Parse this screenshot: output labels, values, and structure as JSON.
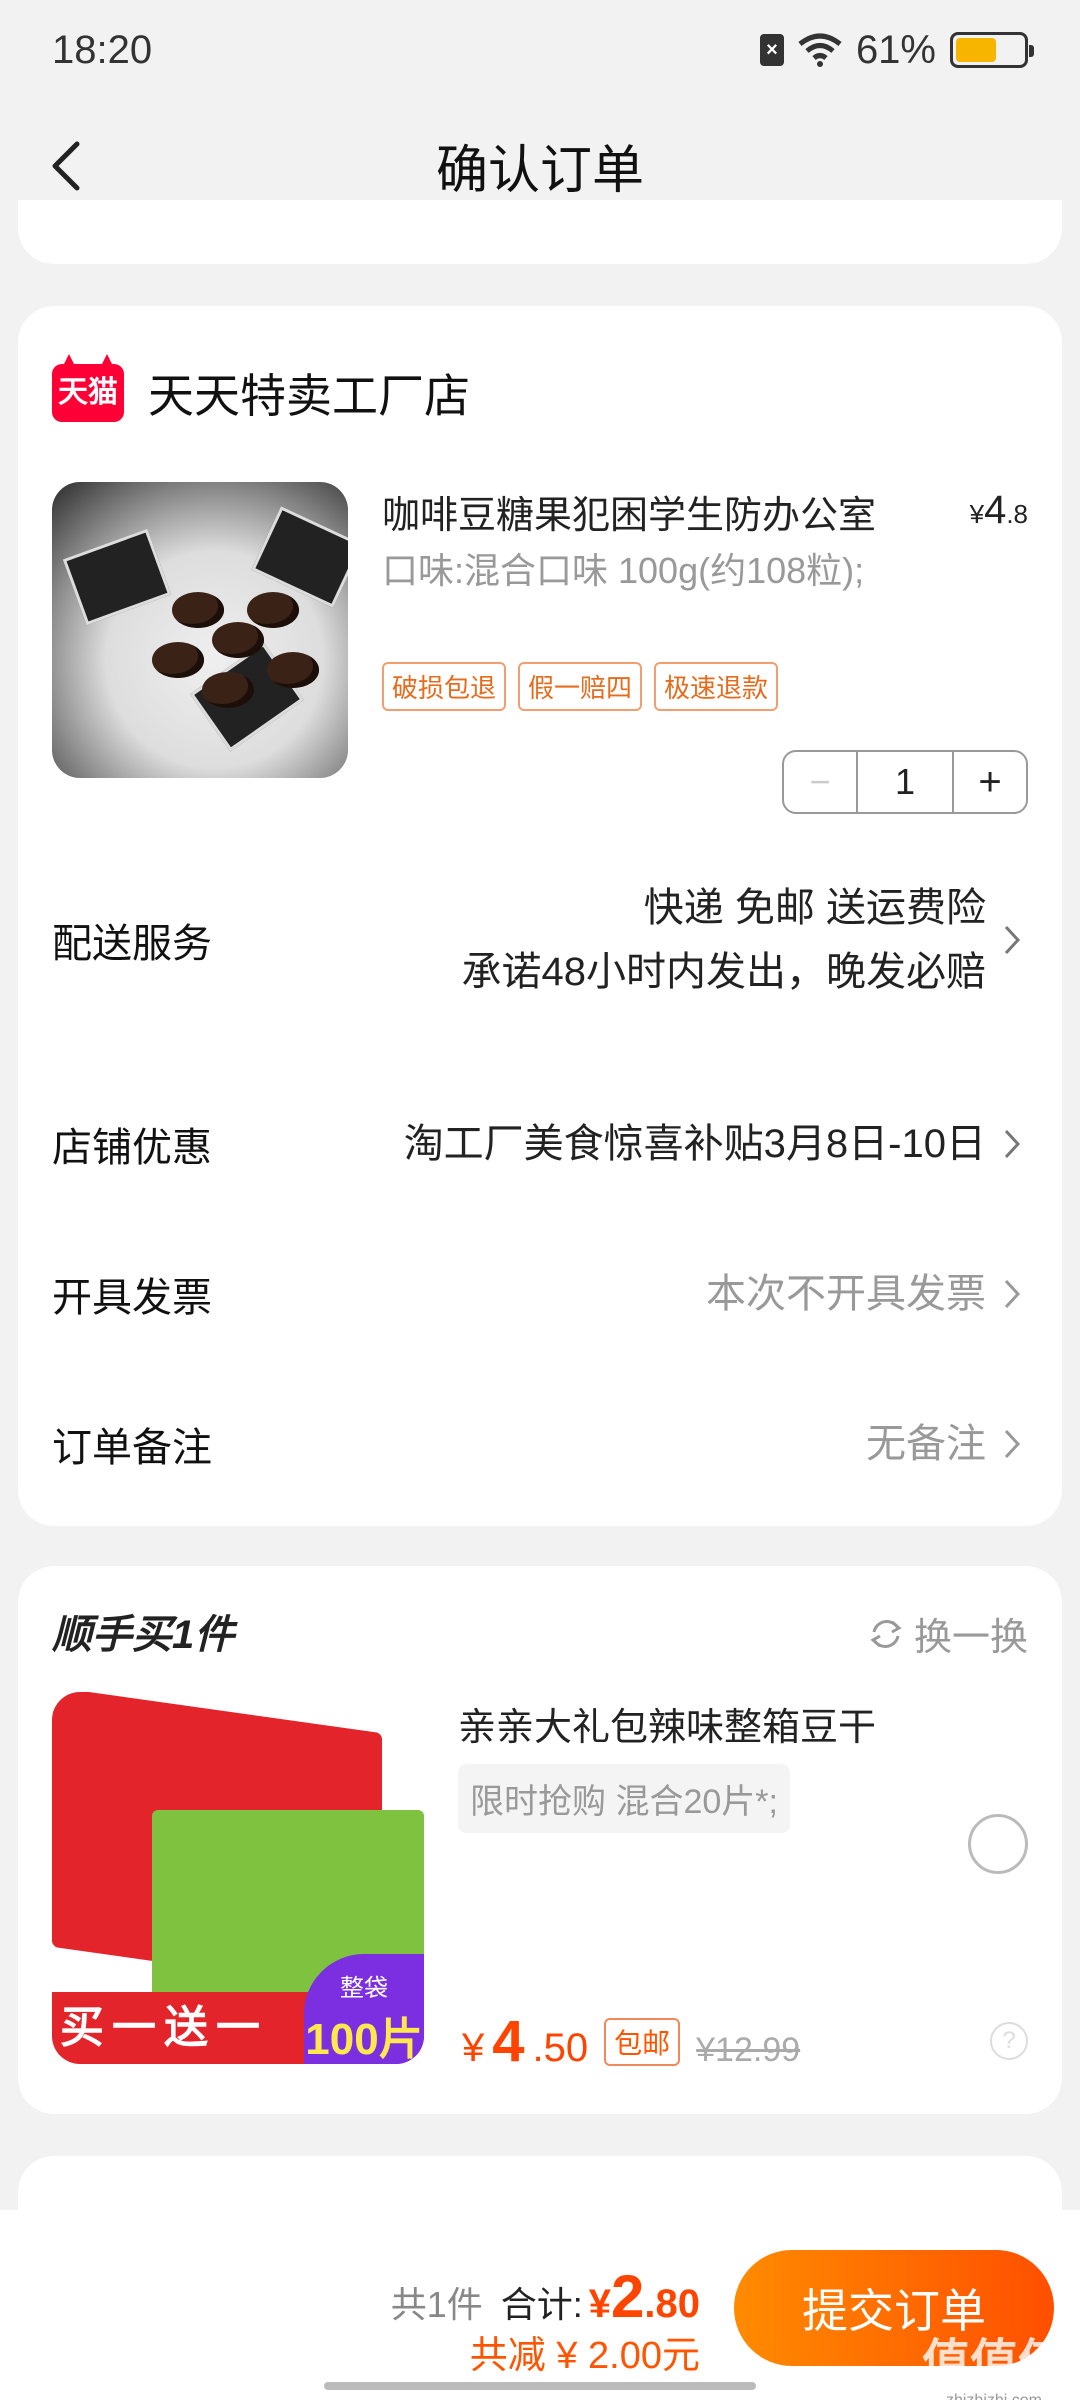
{
  "status_bar": {
    "time": "18:20",
    "battery": "61%",
    "battery_level": 0.61
  },
  "header": {
    "title": "确认订单"
  },
  "store": {
    "badge": "天猫",
    "name": "天天特卖工厂店",
    "product": {
      "title": "咖啡豆糖果犯困学生防办公室",
      "price_symbol": "¥",
      "price_int": "4",
      "price_dec": ".8",
      "spec": "口味:混合口味 100g(约108粒);",
      "tags": [
        "破损包退",
        "假一赔四",
        "极速退款"
      ],
      "quantity": "1",
      "minus": "−",
      "plus": "+"
    },
    "rows": {
      "delivery": {
        "label": "配送服务",
        "line1": "快递 免邮 送运费险",
        "line2": "承诺48小时内发出，晚发必赔"
      },
      "discount": {
        "label": "店铺优惠",
        "value": "淘工厂美食惊喜补贴3月8日-10日"
      },
      "invoice": {
        "label": "开具发票",
        "value": "本次不开具发票"
      },
      "remark": {
        "label": "订单备注",
        "value": "无备注"
      }
    }
  },
  "addon": {
    "title": "顺手买1件",
    "swap": "换一换",
    "name": "亲亲大礼包辣味整箱豆干",
    "spec": "限时抢购 混合20片*;",
    "price_symbol": "¥",
    "price_int": "4",
    "price_dec": ".50",
    "free_shipping": "包邮",
    "original_price": "¥12.99",
    "image_banner": "买一送一",
    "image_badge_top": "整袋",
    "image_badge_num": "100片",
    "help": "?"
  },
  "footer": {
    "count": "共1件",
    "total_label": "合计:",
    "total_symbol": "¥",
    "total_int": "2",
    "total_dec": ".80",
    "discount": "共减 ¥ 2.00元",
    "submit": "提交订单"
  },
  "watermark": {
    "main": "值值值",
    "sub": "zhizhizhi.com"
  },
  "colors": {
    "accent": "#ff5000",
    "tmall_red": "#ff0036",
    "tag_border": "#f0a070"
  }
}
